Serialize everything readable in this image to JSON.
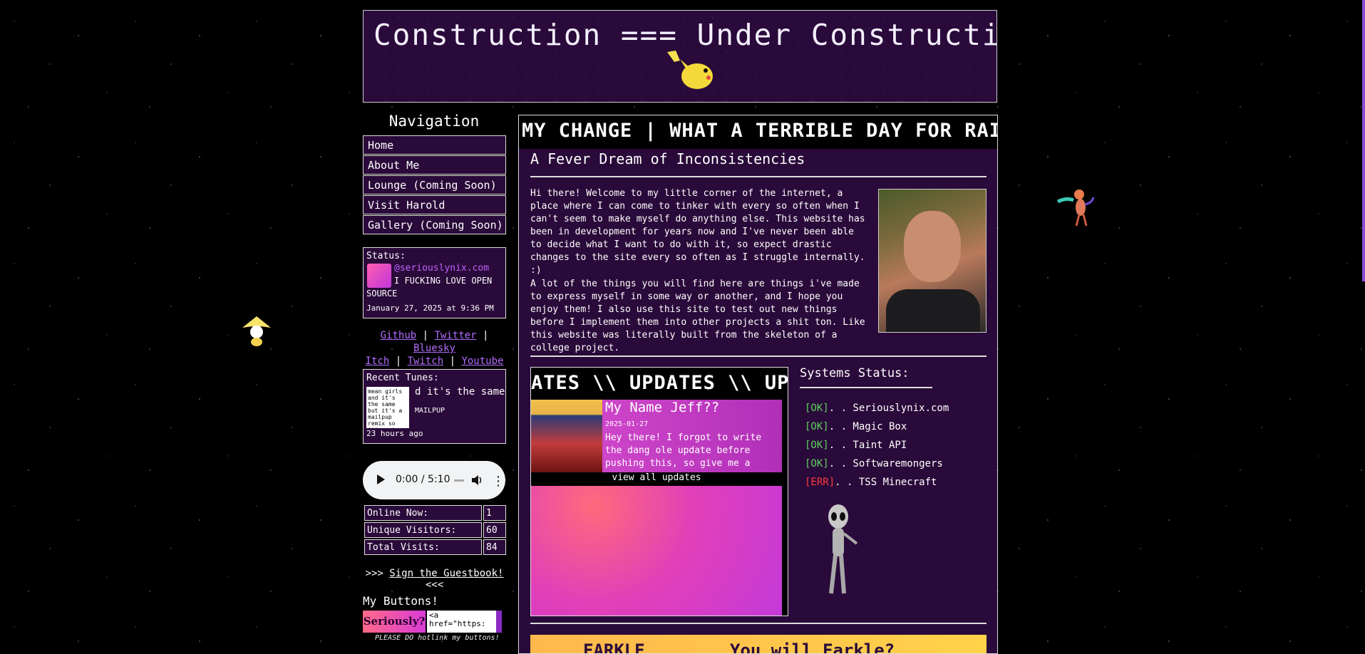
{
  "header": {
    "marquee": "Construction === Under Construction === U"
  },
  "nav": {
    "title": "Navigation",
    "items": [
      "Home",
      "About Me",
      "Lounge (Coming Soon)",
      "Visit Harold",
      "Gallery (Coming Soon)"
    ]
  },
  "status": {
    "label": "Status:",
    "handle": "@seriouslynix.com",
    "post_line1": "I FUCKING LOVE OPEN",
    "post_line2": "SOURCE",
    "timestamp": "January 27, 2025 at 9:36 PM"
  },
  "social": {
    "row1": [
      "Github",
      "Twitter",
      "Bluesky"
    ],
    "row2": [
      "Itch",
      "Twitch",
      "Youtube"
    ],
    "separator": "|"
  },
  "tunes": {
    "label": "Recent Tunes:",
    "art_text": "mean girls and it's the same but it's a mailpup remix so it's not",
    "track_scroll": "d it's the same bu",
    "artist": "MAILPUP",
    "ago": "23 hours ago"
  },
  "audio": {
    "time": "0:00 / 5:10"
  },
  "counter": {
    "rows": [
      {
        "label": "Online Now:",
        "value": "1"
      },
      {
        "label": "Unique Visitors:",
        "value": "60"
      },
      {
        "label": "Total Visits:",
        "value": "84"
      }
    ]
  },
  "guestbook": {
    "prefix": ">>> ",
    "link": "Sign the Guestbook!",
    "suffix": " <<<"
  },
  "buttons": {
    "title": "My Buttons!",
    "badge": "Seriously?",
    "code": "<a href=\"https: ",
    "note": "PLEASE DO hotlink my buttons!"
  },
  "main": {
    "marquee": "MY CHANGE | WHAT A TERRIBLE DAY FOR RAIN | IT",
    "title": "A Fever Dream of Inconsistencies",
    "intro1": "Hi there! Welcome to my little corner of the internet, a place where I can come to tinker with every so often when I can't seem to make myself do anything else. This website has been in development for years now and I've never been able to decide what I want to do with it, so expect drastic changes to the site every so often as I struggle internally. :)",
    "intro2": "A lot of the things you will find here are things i've made to express myself in some way or another, and I hope you enjoy them! I also use this site to test out new things before I implement them into other projects a shit ton. Like this website was literally built from the skeleton of a college project."
  },
  "updates": {
    "marquee": "ATES \\\\ UPDATES \\\\ UPDA",
    "post_title": "My Name Jeff??",
    "post_date": "2025-01-27",
    "post_excerpt": "Hey there! I forgot to write the dang ole update before pushing this, so give me a little bit and I'll...",
    "view_all": "view all updates"
  },
  "systems": {
    "title": "Systems Status:",
    "items": [
      {
        "status": "[OK]",
        "name": ". . Seriouslynix.com",
        "color": "#5fd35f"
      },
      {
        "status": "[OK]",
        "name": ". . Magic Box",
        "color": "#5fd35f"
      },
      {
        "status": "[OK]",
        "name": ". . Taint API",
        "color": "#5fd35f"
      },
      {
        "status": "[OK]",
        "name": ". . Softwaremongers",
        "color": "#5fd35f"
      },
      {
        "status": "[ERR]",
        "name": ". . TSS Minecraft",
        "color": "#ff3a3a"
      }
    ]
  },
  "banner": {
    "left": "FARKLE",
    "right": "You will Farkle?"
  },
  "colors": {
    "background": "#000000",
    "panel": "#2a0a3a",
    "link": "#b36cff",
    "ok": "#5fd35f",
    "err": "#ff3a3a"
  },
  "icons": [
    "pikachu-sprite",
    "jirachi-sprite",
    "deoxys-sprite",
    "alien-sprite",
    "play-icon",
    "volume-icon",
    "more-icon"
  ]
}
